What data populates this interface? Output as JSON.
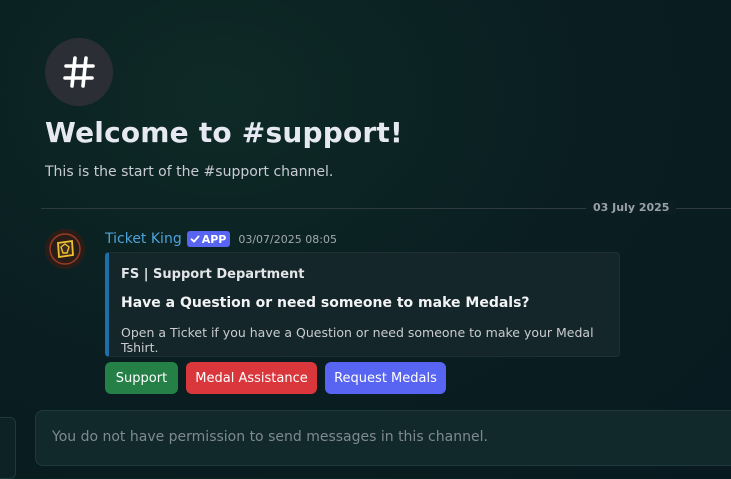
{
  "channel": {
    "icon": "hashtag-icon",
    "welcome_title": "Welcome to #support!",
    "welcome_subtitle": "This is the start of the #support channel."
  },
  "divider": {
    "date": "03 July 2025"
  },
  "message": {
    "avatar_icon": "ticket-king-avatar",
    "author": "Ticket King",
    "badge": "APP",
    "timestamp": "03/07/2025 08:05",
    "embed": {
      "accent_color": "#1e6fa8",
      "author": "FS | Support Department",
      "title": "Have a Question or need someone to make Medals?",
      "description": "Open a Ticket if you have a Question or need someone to make your Medal Tshirt."
    },
    "buttons": [
      {
        "label": "Support",
        "color": "#248046"
      },
      {
        "label": "Medal Assistance",
        "color": "#da373c"
      },
      {
        "label": "Request Medals",
        "color": "#5865f2"
      }
    ]
  },
  "composer": {
    "placeholder": "You do not have permission to send messages in this channel."
  }
}
